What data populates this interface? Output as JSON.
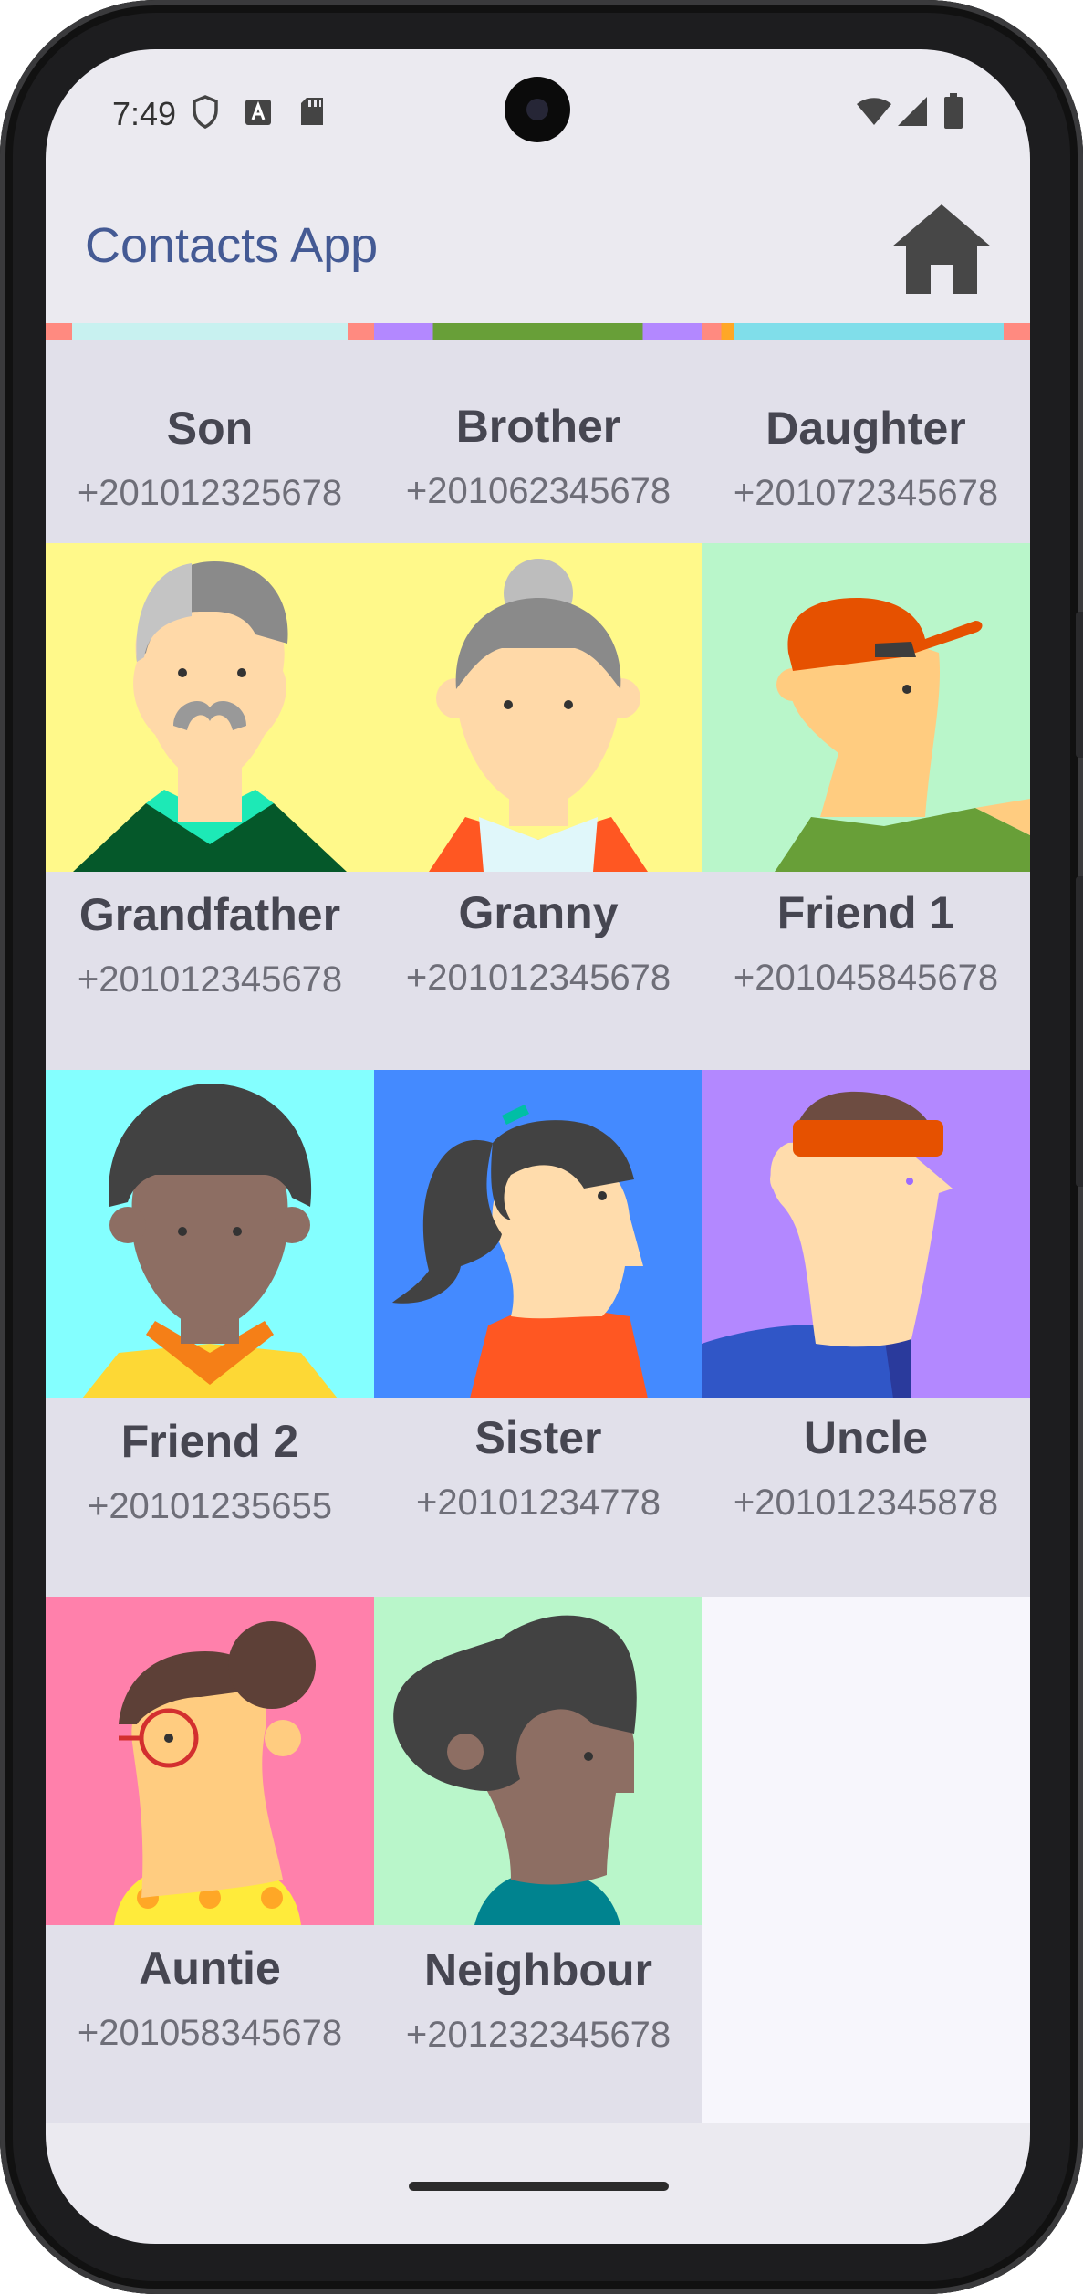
{
  "status_bar": {
    "time": "7:49",
    "left_icons": [
      "shield-icon",
      "a-badge-icon",
      "sd-card-icon"
    ],
    "right_icons": [
      "wifi-icon",
      "signal-icon",
      "battery-icon"
    ]
  },
  "app_bar": {
    "title": "Contacts App",
    "home_icon": "home-icon",
    "title_color": "#445a94"
  },
  "contacts": [
    {
      "name": "Son",
      "phone": "+201012325678",
      "bg": "#c8f1f0"
    },
    {
      "name": "Brother",
      "phone": "+201062345678",
      "bg": "#689f38"
    },
    {
      "name": "Daughter",
      "phone": "+201072345678",
      "bg": "#80deea"
    },
    {
      "name": "Grandfather",
      "phone": "+201012345678",
      "bg": "#fff98a"
    },
    {
      "name": "Granny",
      "phone": "+201012345678",
      "bg": "#fff98a"
    },
    {
      "name": "Friend 1",
      "phone": "+201045845678",
      "bg": "#b9f6ca"
    },
    {
      "name": "Friend 2",
      "phone": "+20101235655",
      "bg": "#84ffff"
    },
    {
      "name": "Sister",
      "phone": "+20101234778",
      "bg": "#448aff"
    },
    {
      "name": "Uncle",
      "phone": "+201012345878",
      "bg": "#b388ff"
    },
    {
      "name": "Auntie",
      "phone": "+201058345678",
      "bg": "#ff80ab"
    },
    {
      "name": "Neighbour",
      "phone": "+201232345678",
      "bg": "#b9f6ca"
    }
  ]
}
